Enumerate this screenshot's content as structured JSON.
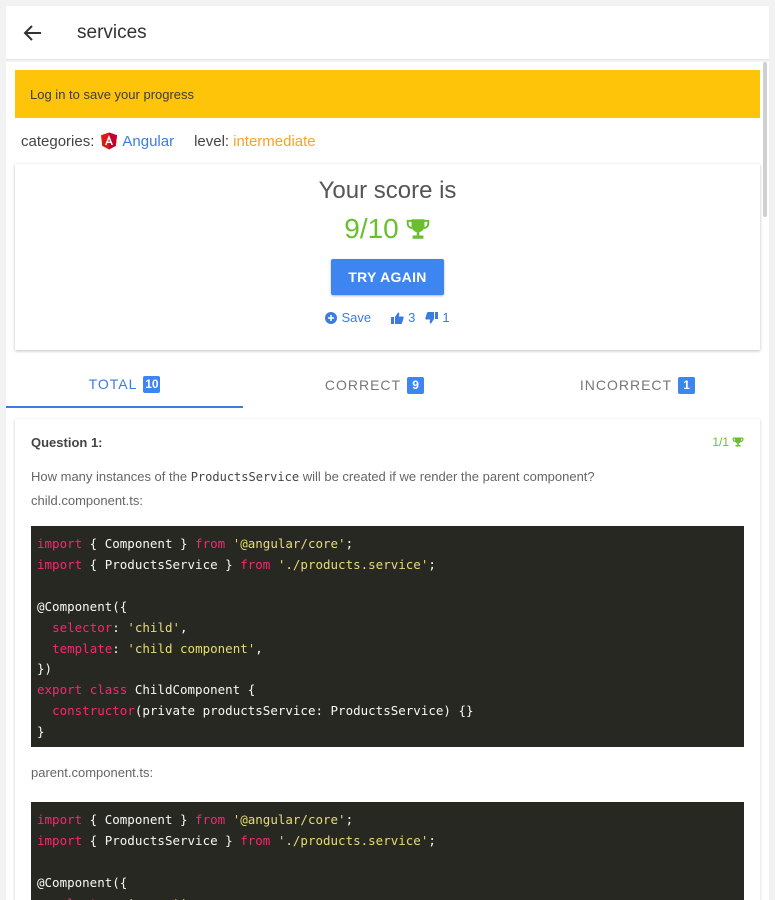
{
  "appbar": {
    "title": "services",
    "back_icon": "arrow-left-icon"
  },
  "banner": {
    "text": "Log in to save your progress"
  },
  "meta": {
    "categories_label": "categories:",
    "category": "Angular",
    "level_label": "level:",
    "level": "intermediate"
  },
  "score": {
    "title": "Your score is",
    "value": "9/10",
    "try_again": "TRY AGAIN",
    "save_label": "Save",
    "likes": "3",
    "dislikes": "1"
  },
  "tabs": [
    {
      "label": "TOTAL",
      "count": "10"
    },
    {
      "label": "CORRECT",
      "count": "9"
    },
    {
      "label": "INCORRECT",
      "count": "1"
    }
  ],
  "question": {
    "label": "Question 1:",
    "points": "1/1",
    "text_before": "How many instances of the ",
    "code_ref": "ProductsService",
    "text_after": " will be created if we render the parent component?",
    "file1": "child.component.ts:",
    "file2": "parent.component.ts:"
  },
  "colors": {
    "accent": "#3d85f0",
    "banner": "#fdc40a",
    "success": "#6abf2e",
    "level": "#f9a321",
    "code_bg": "#272822"
  }
}
